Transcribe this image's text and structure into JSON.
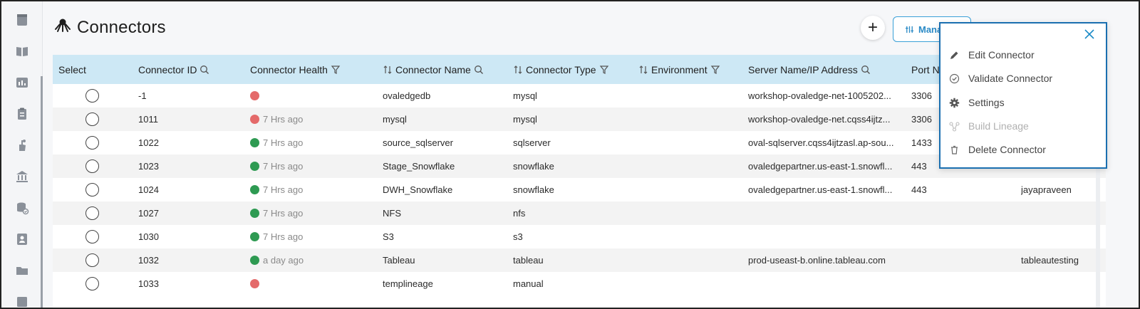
{
  "page": {
    "title": "Connectors"
  },
  "toolbar": {
    "add_label": "+",
    "manage_label": "Manage B"
  },
  "sidebar": {
    "icons": [
      "dashboard-icon",
      "book-icon",
      "reports-icon",
      "clipboard-icon",
      "hand-icon",
      "bank-icon",
      "database-check-icon",
      "contact-icon",
      "folder-icon"
    ]
  },
  "table": {
    "headers": {
      "select": "Select",
      "connector_id": "Connector ID",
      "health": "Connector Health",
      "name": "Connector Name",
      "type": "Connector Type",
      "environment": "Environment",
      "server": "Server Name/IP Address",
      "port": "Port N"
    },
    "rows": [
      {
        "id": "-1",
        "health_color": "#e46a6a",
        "health_text": "",
        "name": "ovaledgedb",
        "type": "mysql",
        "server": "workshop-ovaledge-net-1005202...",
        "port": "3306",
        "user": ""
      },
      {
        "id": "1011",
        "health_color": "#e46a6a",
        "health_text": "7 Hrs ago",
        "name": "mysql",
        "type": "mysql",
        "server": "workshop-ovaledge-net.cqss4ijtz...",
        "port": "3306",
        "user": ""
      },
      {
        "id": "1022",
        "health_color": "#2e9a52",
        "health_text": "7 Hrs ago",
        "name": "source_sqlserver",
        "type": "sqlserver",
        "server": "oval-sqlserver.cqss4ijtzasl.ap-sou...",
        "port": "1433",
        "user": ""
      },
      {
        "id": "1023",
        "health_color": "#2e9a52",
        "health_text": "7 Hrs ago",
        "name": "Stage_Snowflake",
        "type": "snowflake",
        "server": "ovaledgepartner.us-east-1.snowfl...",
        "port": "443",
        "user": ""
      },
      {
        "id": "1024",
        "health_color": "#2e9a52",
        "health_text": "7 Hrs ago",
        "name": "DWH_Snowflake",
        "type": "snowflake",
        "server": "ovaledgepartner.us-east-1.snowfl...",
        "port": "443",
        "user": "jayapraveen"
      },
      {
        "id": "1027",
        "health_color": "#2e9a52",
        "health_text": "7 Hrs ago",
        "name": "NFS",
        "type": "nfs",
        "server": "",
        "port": "",
        "user": ""
      },
      {
        "id": "1030",
        "health_color": "#2e9a52",
        "health_text": "7 Hrs ago",
        "name": "S3",
        "type": "s3",
        "server": "",
        "port": "",
        "user": ""
      },
      {
        "id": "1032",
        "health_color": "#2e9a52",
        "health_text": "a day ago",
        "name": "Tableau",
        "type": "tableau",
        "server": "prod-useast-b.online.tableau.com",
        "port": "",
        "user": "tableautesting"
      },
      {
        "id": "1033",
        "health_color": "#e46a6a",
        "health_text": "",
        "name": "templineage",
        "type": "manual",
        "server": "",
        "port": "",
        "user": ""
      }
    ]
  },
  "menu": {
    "items": [
      {
        "label": "Edit Connector",
        "icon": "pencil-icon",
        "disabled": false
      },
      {
        "label": "Validate Connector",
        "icon": "check-circle-icon",
        "disabled": false
      },
      {
        "label": "Settings",
        "icon": "gear-icon",
        "disabled": false
      },
      {
        "label": "Build Lineage",
        "icon": "lineage-icon",
        "disabled": true
      },
      {
        "label": "Delete Connector",
        "icon": "trash-icon",
        "disabled": false
      }
    ]
  },
  "colors": {
    "header_bg": "#cde8f5",
    "accent": "#2a8ac6",
    "health_red": "#e46a6a",
    "health_green": "#2e9a52"
  }
}
